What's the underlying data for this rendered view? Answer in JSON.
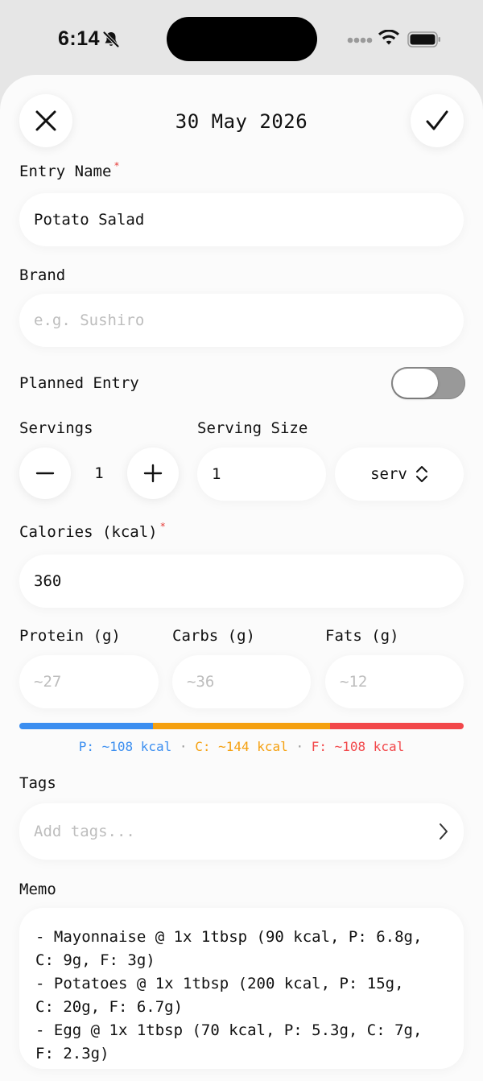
{
  "status_bar": {
    "time": "6:14"
  },
  "header": {
    "date": "30 May 2026"
  },
  "entry_name": {
    "label": "Entry Name",
    "required_mark": "*",
    "value": "Potato Salad"
  },
  "brand": {
    "label": "Brand",
    "placeholder": "e.g. Sushiro"
  },
  "planned_entry": {
    "label": "Planned Entry",
    "enabled": false
  },
  "servings": {
    "label": "Servings",
    "value": "1",
    "minus": "−",
    "plus": "+"
  },
  "serving_size": {
    "label": "Serving Size",
    "value": "1",
    "unit": "serv"
  },
  "calories": {
    "label": "Calories (kcal)",
    "required_mark": "*",
    "value": "360"
  },
  "macros": {
    "protein": {
      "label": "Protein (g)",
      "placeholder": "~27",
      "legend": "P: ~108 kcal",
      "kcal": 108,
      "color": "#3b8ef0"
    },
    "carbs": {
      "label": "Carbs (g)",
      "placeholder": "~36",
      "legend": "C: ~144 kcal",
      "kcal": 144,
      "color": "#f5a00f"
    },
    "fats": {
      "label": "Fats (g)",
      "placeholder": "~12",
      "legend": "F: ~108 kcal",
      "kcal": 108,
      "color": "#f2474a"
    },
    "separator": "·"
  },
  "tags": {
    "label": "Tags",
    "placeholder": "Add tags..."
  },
  "memo": {
    "label": "Memo",
    "value": "- Mayonnaise @ 1x 1tbsp (90 kcal, P: 6.8g,\nC: 9g, F: 3g)\n- Potatoes @ 1x 1tbsp (200 kcal, P: 15g,\nC: 20g, F: 6.7g)\n- Egg @ 1x 1tbsp (70 kcal, P: 5.3g, C: 7g,\nF: 2.3g)"
  }
}
